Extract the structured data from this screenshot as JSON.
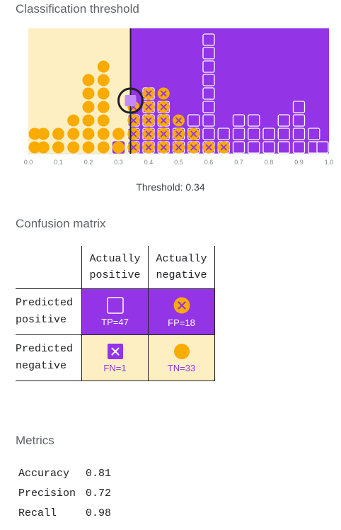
{
  "classification": {
    "title": "Classification threshold",
    "threshold_label": "Threshold: 0.34",
    "threshold": 0.34,
    "x_ticks": [
      "0.0",
      "0.1",
      "0.2",
      "0.3",
      "0.4",
      "0.5",
      "0.6",
      "0.7",
      "0.8",
      "0.9",
      "1.0"
    ],
    "colors": {
      "positive": "#9334e6",
      "negative": "#f9ab00",
      "neg_bg": "#feefc3"
    },
    "negative_columns": [
      {
        "score": 0.0,
        "count": 2
      },
      {
        "score": 0.05,
        "count": 2
      },
      {
        "score": 0.1,
        "count": 2
      },
      {
        "score": 0.15,
        "count": 3
      },
      {
        "score": 0.2,
        "count": 6
      },
      {
        "score": 0.25,
        "count": 7
      },
      {
        "score": 0.3,
        "count": 2
      },
      {
        "score": 0.35,
        "count": 4
      },
      {
        "score": 0.4,
        "count": 5
      },
      {
        "score": 0.45,
        "count": 5
      },
      {
        "score": 0.5,
        "count": 3
      },
      {
        "score": 0.55,
        "count": 2
      },
      {
        "score": 0.6,
        "count": 1
      },
      {
        "score": 0.65,
        "count": 1
      }
    ],
    "positive_columns": [
      {
        "score": 0.3,
        "count": 1
      },
      {
        "score": 0.35,
        "count": 3
      },
      {
        "score": 0.4,
        "count": 5
      },
      {
        "score": 0.45,
        "count": 4
      },
      {
        "score": 0.5,
        "count": 2
      },
      {
        "score": 0.55,
        "count": 3
      },
      {
        "score": 0.6,
        "count": 9
      },
      {
        "score": 0.65,
        "count": 2
      },
      {
        "score": 0.7,
        "count": 3
      },
      {
        "score": 0.75,
        "count": 3
      },
      {
        "score": 0.8,
        "count": 2
      },
      {
        "score": 0.85,
        "count": 3
      },
      {
        "score": 0.9,
        "count": 4
      },
      {
        "score": 0.95,
        "count": 2
      },
      {
        "score": 1.0,
        "count": 1
      }
    ]
  },
  "confusion": {
    "title": "Confusion matrix",
    "col_headers": [
      [
        "Actually",
        "positive"
      ],
      [
        "Actually",
        "negative"
      ]
    ],
    "row_headers": [
      [
        "Predicted",
        "positive"
      ],
      [
        "Predicted",
        "negative"
      ]
    ],
    "tp_label": "TP=47",
    "fp_label": "FP=18",
    "fn_label": "FN=1",
    "tn_label": "TN=33"
  },
  "metrics": {
    "title": "Metrics",
    "rows": [
      {
        "name": "Accuracy",
        "value": "0.81"
      },
      {
        "name": "Precision",
        "value": "0.72"
      },
      {
        "name": "Recall",
        "value": "0.98"
      }
    ]
  }
}
